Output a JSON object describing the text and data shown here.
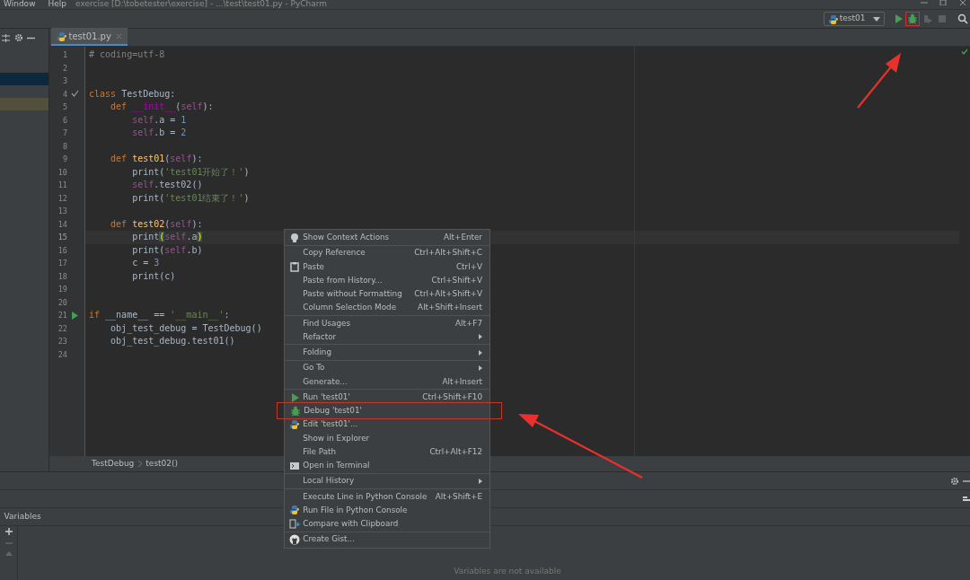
{
  "title_bar": {
    "menus": [
      "Window",
      "Help"
    ],
    "title": "exercise [D:\\tobetester\\exercise] - ...\\test\\test01.py - PyCharm"
  },
  "toolbar": {
    "run_config": "test01",
    "debug_highlighted": true
  },
  "editor_tab": {
    "label": "test01.py",
    "selected": true
  },
  "code_lines": [
    {
      "number": "1",
      "kind": "plain",
      "tokens": [
        {
          "kind": "comment",
          "text": "# coding=utf-8"
        }
      ]
    },
    {
      "number": "2",
      "kind": "plain"
    },
    {
      "number": "3",
      "kind": "plain"
    },
    {
      "number": "4",
      "kind": "check",
      "tokens": [
        {
          "kind": "kw",
          "text": "class "
        },
        {
          "kind": "plain",
          "text": "TestDebug:"
        }
      ]
    },
    {
      "number": "5",
      "kind": "plain",
      "tokens": [
        {
          "kind": "kw",
          "text": "    def "
        },
        {
          "kind": "magic",
          "text": "__init__"
        },
        {
          "kind": "plain",
          "text": "("
        },
        {
          "kind": "self",
          "text": "self"
        },
        {
          "kind": "plain",
          "text": "):"
        }
      ]
    },
    {
      "number": "6",
      "kind": "plain",
      "tokens": [
        {
          "kind": "self",
          "text": "        self"
        },
        {
          "kind": "plain",
          "text": ".a = "
        },
        {
          "kind": "num",
          "text": "1"
        }
      ]
    },
    {
      "number": "7",
      "kind": "plain",
      "tokens": [
        {
          "kind": "self",
          "text": "        self"
        },
        {
          "kind": "plain",
          "text": ".b = "
        },
        {
          "kind": "num",
          "text": "2"
        }
      ]
    },
    {
      "number": "8",
      "kind": "plain"
    },
    {
      "number": "9",
      "kind": "plain",
      "tokens": [
        {
          "kind": "kw",
          "text": "    def "
        },
        {
          "kind": "fn",
          "text": "test01"
        },
        {
          "kind": "plain",
          "text": "("
        },
        {
          "kind": "self",
          "text": "self"
        },
        {
          "kind": "plain",
          "text": "):"
        }
      ]
    },
    {
      "number": "10",
      "kind": "plain",
      "tokens": [
        {
          "kind": "plain",
          "text": "        print("
        },
        {
          "kind": "str",
          "text": "'test01开始了！'"
        },
        {
          "kind": "plain",
          "text": ")"
        }
      ]
    },
    {
      "number": "11",
      "kind": "plain",
      "tokens": [
        {
          "kind": "self",
          "text": "        self"
        },
        {
          "kind": "plain",
          "text": ".test02()"
        }
      ]
    },
    {
      "number": "12",
      "kind": "plain",
      "tokens": [
        {
          "kind": "plain",
          "text": "        print("
        },
        {
          "kind": "str",
          "text": "'test01结束了！'"
        },
        {
          "kind": "plain",
          "text": ")"
        }
      ]
    },
    {
      "number": "13",
      "kind": "plain"
    },
    {
      "number": "14",
      "kind": "plain",
      "tokens": [
        {
          "kind": "kw",
          "text": "    def "
        },
        {
          "kind": "fn",
          "text": "test02"
        },
        {
          "kind": "plain",
          "text": "("
        },
        {
          "kind": "self",
          "text": "self"
        },
        {
          "kind": "plain",
          "text": "):"
        }
      ]
    },
    {
      "number": "15",
      "kind": "plain",
      "current": true,
      "tokens": [
        {
          "kind": "plain",
          "text": "        print"
        },
        {
          "kind": "match",
          "text": "("
        },
        {
          "kind": "self",
          "text": "self"
        },
        {
          "kind": "plain",
          "text": ".a"
        },
        {
          "kind": "match",
          "text": ")"
        }
      ]
    },
    {
      "number": "16",
      "kind": "plain",
      "tokens": [
        {
          "kind": "plain",
          "text": "        print("
        },
        {
          "kind": "self",
          "text": "self"
        },
        {
          "kind": "plain",
          "text": ".b)"
        }
      ]
    },
    {
      "number": "17",
      "kind": "plain",
      "tokens": [
        {
          "kind": "plain",
          "text": "        c = "
        },
        {
          "kind": "num",
          "text": "3"
        }
      ]
    },
    {
      "number": "18",
      "kind": "plain",
      "tokens": [
        {
          "kind": "plain",
          "text": "        print(c)"
        }
      ]
    },
    {
      "number": "19",
      "kind": "plain"
    },
    {
      "number": "20",
      "kind": "plain"
    },
    {
      "number": "21",
      "kind": "run",
      "tokens": [
        {
          "kind": "kw",
          "text": "if "
        },
        {
          "kind": "plain",
          "text": "__name__ == "
        },
        {
          "kind": "str",
          "text": "'__main__'"
        },
        {
          "kind": "plain",
          "text": ":"
        }
      ]
    },
    {
      "number": "22",
      "kind": "plain",
      "tokens": [
        {
          "kind": "plain",
          "text": "    obj_test_debug = TestDebug()"
        }
      ]
    },
    {
      "number": "23",
      "kind": "plain",
      "tokens": [
        {
          "kind": "plain",
          "text": "    obj_test_debug.test01()"
        }
      ]
    },
    {
      "number": "24",
      "kind": "plain"
    }
  ],
  "breadcrumbs": [
    "TestDebug",
    "test02()"
  ],
  "context_menu": {
    "groups": [
      [
        {
          "label": "Show Context Actions",
          "shortcut": "Alt+Enter",
          "kind": "bulb"
        }
      ],
      [
        {
          "label": "Copy Reference",
          "shortcut": "Ctrl+Alt+Shift+C",
          "kind": "text"
        },
        {
          "label": "Paste",
          "shortcut": "Ctrl+V",
          "kind": "paste"
        },
        {
          "label": "Paste from History...",
          "shortcut": "Ctrl+Shift+V",
          "kind": "text"
        },
        {
          "label": "Paste without Formatting",
          "shortcut": "Ctrl+Alt+Shift+V",
          "kind": "text"
        },
        {
          "label": "Column Selection Mode",
          "shortcut": "Alt+Shift+Insert",
          "kind": "text"
        }
      ],
      [
        {
          "label": "Find Usages",
          "shortcut": "Alt+F7",
          "kind": "text"
        },
        {
          "label": "Refactor",
          "submenu": true,
          "kind": "text"
        }
      ],
      [
        {
          "label": "Folding",
          "submenu": true,
          "kind": "text"
        }
      ],
      [
        {
          "label": "Go To",
          "submenu": true,
          "kind": "text"
        },
        {
          "label": "Generate...",
          "shortcut": "Alt+Insert",
          "kind": "text"
        }
      ],
      [
        {
          "label": "Run 'test01'",
          "shortcut": "Ctrl+Shift+F10",
          "kind": "run"
        },
        {
          "label": "Debug 'test01'",
          "kind": "debug",
          "highlighted": true
        },
        {
          "label": "Edit 'test01'...",
          "kind": "python"
        },
        {
          "label": "Show in Explorer",
          "kind": "text"
        },
        {
          "label": "File Path",
          "shortcut": "Ctrl+Alt+F12",
          "kind": "text"
        },
        {
          "label": "Open in Terminal",
          "kind": "terminal"
        }
      ],
      [
        {
          "label": "Local History",
          "submenu": true,
          "kind": "text"
        }
      ],
      [
        {
          "label": "Execute Line in Python Console",
          "shortcut": "Alt+Shift+E",
          "kind": "text"
        },
        {
          "label": "Run File in Python Console",
          "kind": "python"
        },
        {
          "label": "Compare with Clipboard",
          "kind": "compare"
        }
      ],
      [
        {
          "label": "Create Gist...",
          "kind": "github"
        }
      ]
    ]
  },
  "debug_panel": {
    "tab": "Variables",
    "empty_text": "Variables are not available"
  }
}
